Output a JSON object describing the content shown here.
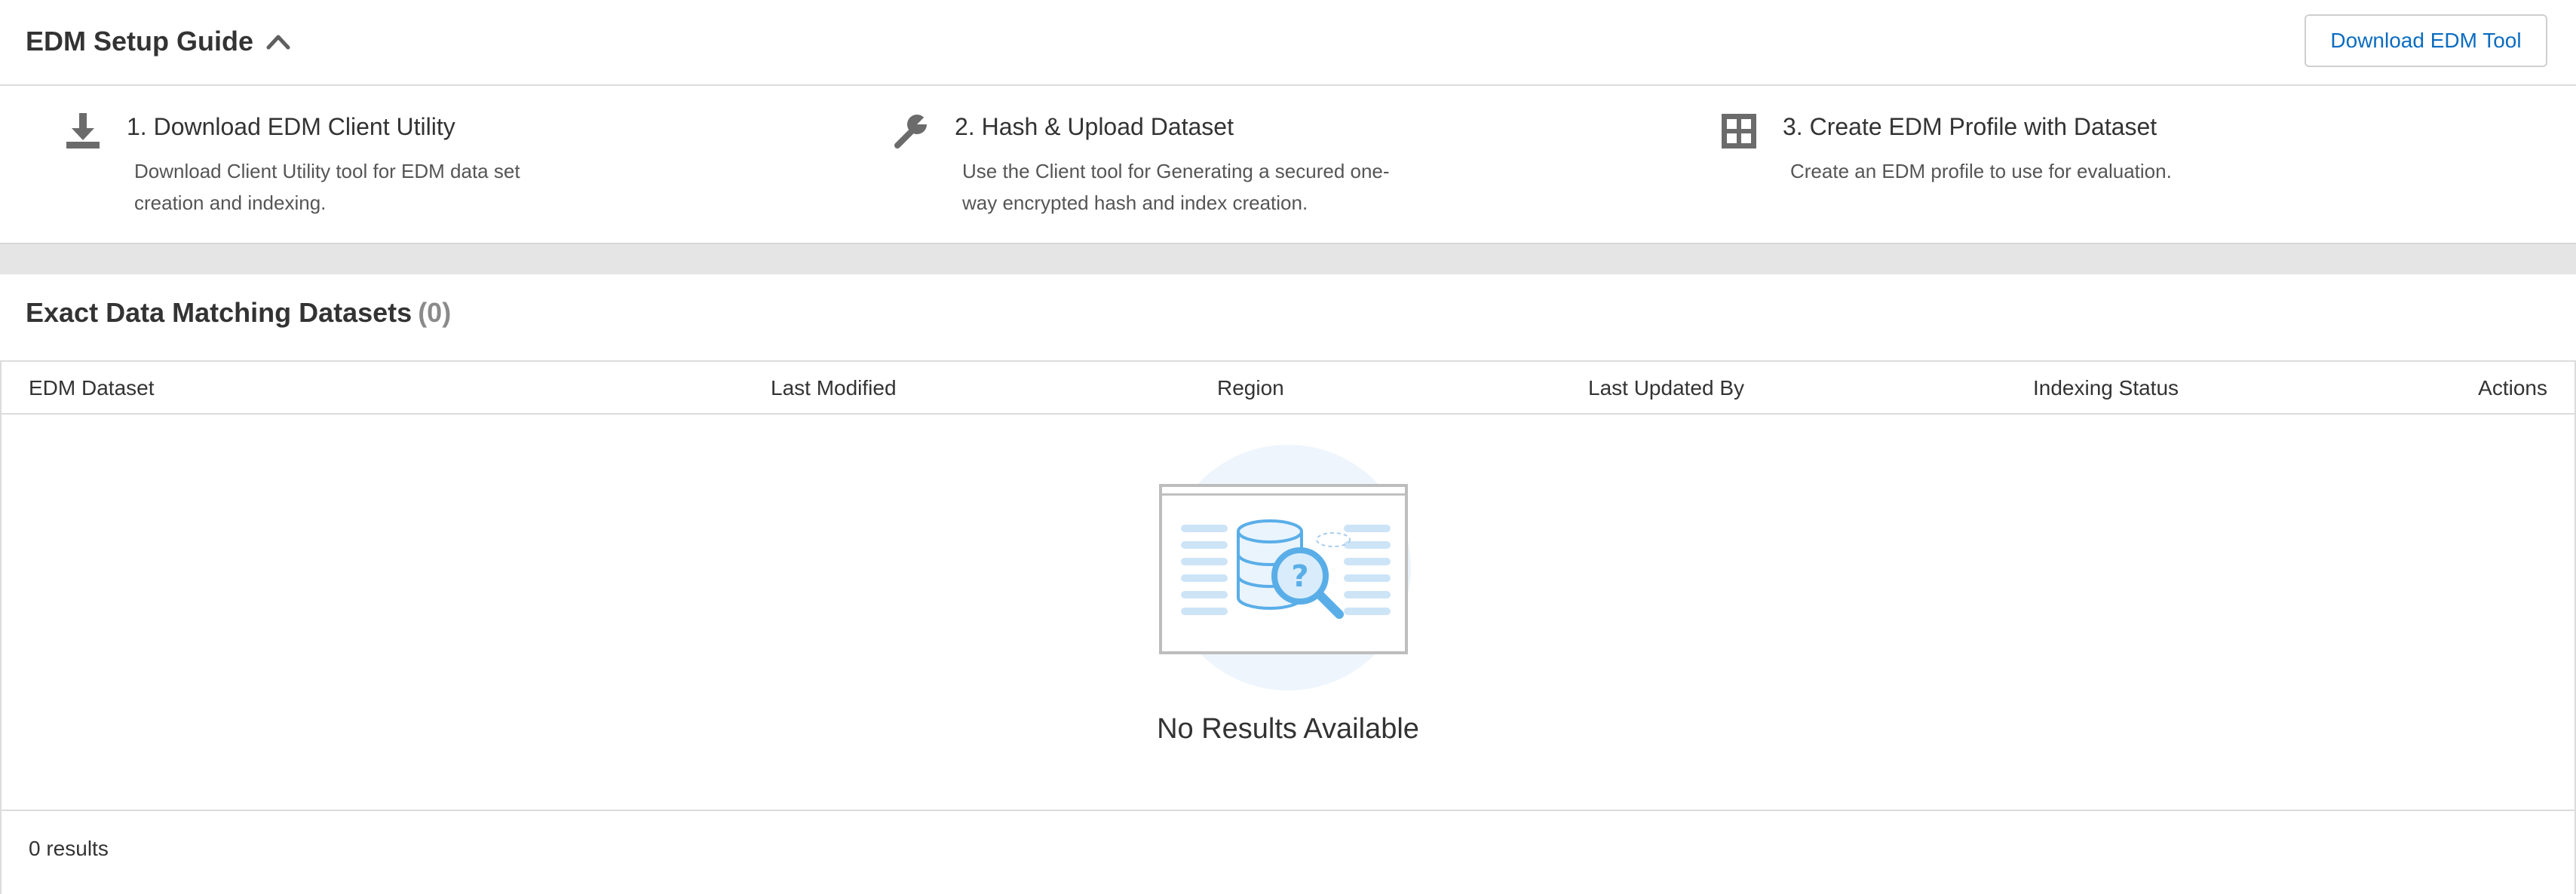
{
  "guide": {
    "title": "EDM Setup Guide",
    "collapse_icon": "chevron-up-icon",
    "download_button_label": "Download EDM Tool",
    "steps": [
      {
        "icon": "download-icon",
        "title": "1. Download EDM Client Utility",
        "description": "Download Client Utility tool for EDM data set creation and indexing."
      },
      {
        "icon": "wrench-icon",
        "title": "2. Hash & Upload Dataset",
        "description": "Use the Client tool for Generating a secured one-way encrypted hash and index creation."
      },
      {
        "icon": "grid-icon",
        "title": "3. Create EDM Profile with Dataset",
        "description": "Create an EDM profile to use for evaluation."
      }
    ]
  },
  "datasets": {
    "title": "Exact Data Matching Datasets",
    "count": "(0)",
    "columns": [
      "EDM Dataset",
      "Last Modified",
      "Region",
      "Last Updated By",
      "Indexing Status",
      "Actions"
    ],
    "rows": [],
    "empty_message": "No Results Available",
    "empty_icon": "no-results-illustration",
    "results_label": "0 results"
  },
  "colors": {
    "accent": "#0b6cc1",
    "icon_grey": "#6b6b6b",
    "illustration_blue": "#5aaee8",
    "illustration_light": "#eaf3fc"
  }
}
